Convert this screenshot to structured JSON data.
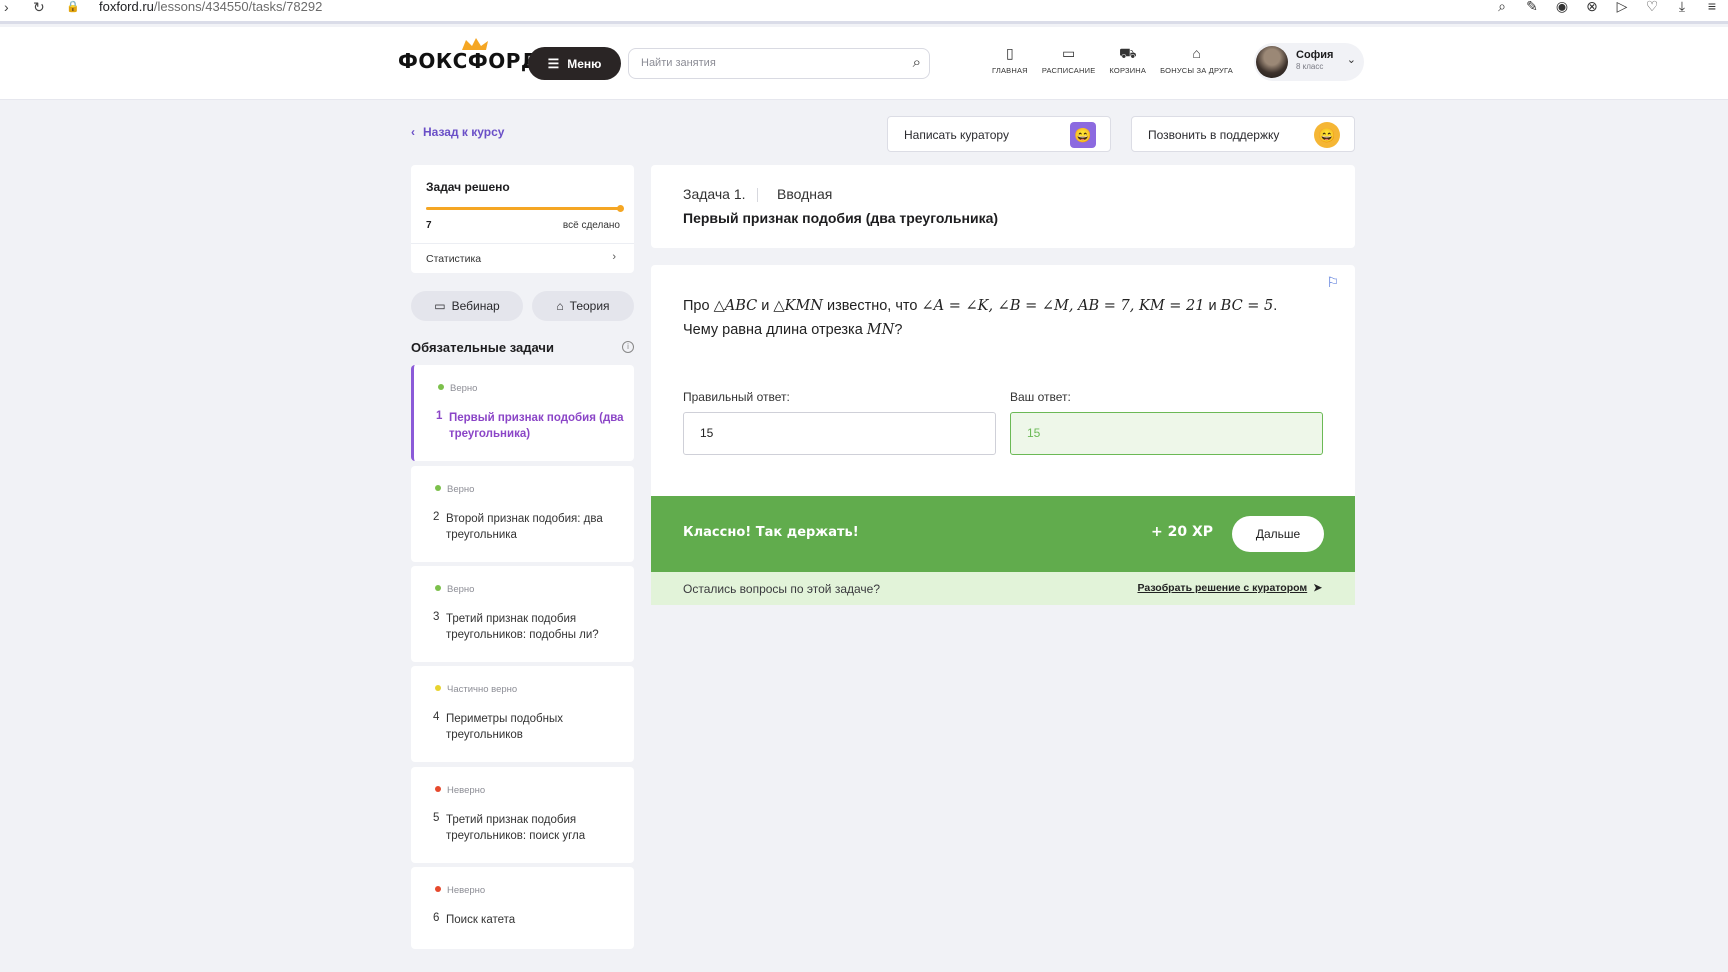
{
  "browser": {
    "url_host": "foxford.ru",
    "url_path": "/lessons/434550/tasks/78292",
    "nav_icons": [
      "forward-icon",
      "reload-icon",
      "lock-icon"
    ],
    "tool_icons": [
      "zoom-icon",
      "edit-icon",
      "camera-icon",
      "close-circle-icon",
      "play-icon",
      "heart-icon",
      "download-icon",
      "extensions-icon"
    ]
  },
  "header": {
    "logo": "ФОКСФОРД",
    "menu_label": "Меню",
    "search_placeholder": "Найти занятия",
    "nav": [
      {
        "label": "ГЛАВНАЯ",
        "icon": "home-icon"
      },
      {
        "label": "РАСПИСАНИЕ",
        "icon": "calendar-icon"
      },
      {
        "label": "КОРЗИНА",
        "icon": "cart-icon"
      },
      {
        "label": "БОНУСЫ ЗА ДРУГА",
        "icon": "gift-icon"
      }
    ],
    "user": {
      "name": "София",
      "grade": "8 класс"
    }
  },
  "top_actions": {
    "back_label": "Назад к курсу",
    "curator_label": "Написать куратору",
    "support_label": "Позвонить в поддержку"
  },
  "sidebar": {
    "progress_title": "Задач решено",
    "progress_fraction": 1.0,
    "solved_count": "7",
    "done_label": "всё сделано",
    "stats_label": "Статистика",
    "webinar_label": "Вебинар",
    "theory_label": "Теория",
    "required_title": "Обязательные задачи",
    "tasks": [
      {
        "status": "Верно",
        "status_color": "#7cc04b",
        "num": "1",
        "title": "Первый признак подобия (два треугольника)",
        "active": true
      },
      {
        "status": "Верно",
        "status_color": "#7cc04b",
        "num": "2",
        "title": "Второй признак подобия: два треугольника",
        "active": false
      },
      {
        "status": "Верно",
        "status_color": "#7cc04b",
        "num": "3",
        "title": "Третий признак подобия треугольников: подобны ли?",
        "active": false
      },
      {
        "status": "Частично верно",
        "status_color": "#e8d32f",
        "num": "4",
        "title": "Периметры подобных треугольников",
        "active": false
      },
      {
        "status": "Неверно",
        "status_color": "#e6492d",
        "num": "5",
        "title": "Третий признак подобия треугольников: поиск угла",
        "active": false
      },
      {
        "status": "Неверно",
        "status_color": "#e6492d",
        "num": "6",
        "title": "Поиск катета",
        "active": false
      }
    ]
  },
  "task": {
    "number": "Задача 1.",
    "kind": "Вводная",
    "name": "Первый признак подобия (два треугольника)",
    "q_pre1": "Про ",
    "q_m1": "△ABC",
    "q_and": " и ",
    "q_m2": "△KMN",
    "q_known": " известно, что ",
    "q_m3": "∠A = ∠K, ∠B = ∠M, AB = 7, KM = 21",
    "q_and2": " и ",
    "q_m4": "BC = 5",
    "q_dot": ".",
    "q2_pre": "Чему равна длина отрезка ",
    "q2_m": "MN",
    "q2_post": "?",
    "correct_label": "Правильный ответ:",
    "correct_value": "15",
    "your_label": "Ваш ответ:",
    "your_value": "15"
  },
  "result": {
    "message": "Классно! Так держать!",
    "xp": "+ 20 XP",
    "next_label": "Дальше",
    "question": "Остались вопросы по этой задаче?",
    "curator_link": "Разобрать решение с куратором"
  },
  "colors": {
    "accent_purple": "#8b45c7",
    "success_green": "#61ac4d",
    "progress_orange": "#f5a623"
  }
}
